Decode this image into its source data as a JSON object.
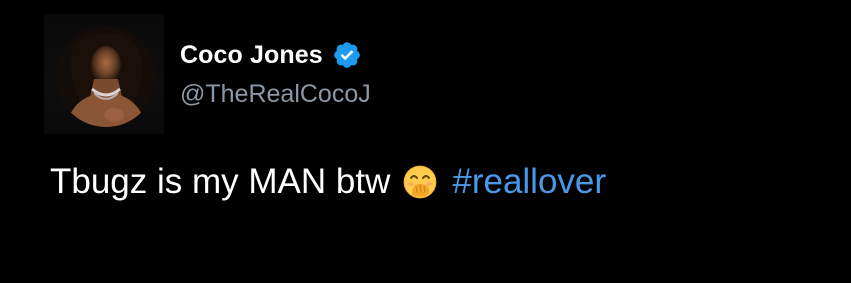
{
  "author": {
    "display_name": "Coco Jones",
    "handle": "@TheRealCocoJ",
    "verified": true,
    "avatar_icon": "profile-photo"
  },
  "tweet": {
    "text": "Tbugz is my MAN btw",
    "emoji_icon": "face-with-hand-over-mouth-icon",
    "hashtag": "#reallover"
  },
  "colors": {
    "background": "#000000",
    "text": "#ffffff",
    "handle": "#8b98a5",
    "link": "#4a99e9",
    "verified_badge": "#1d9bf0"
  }
}
